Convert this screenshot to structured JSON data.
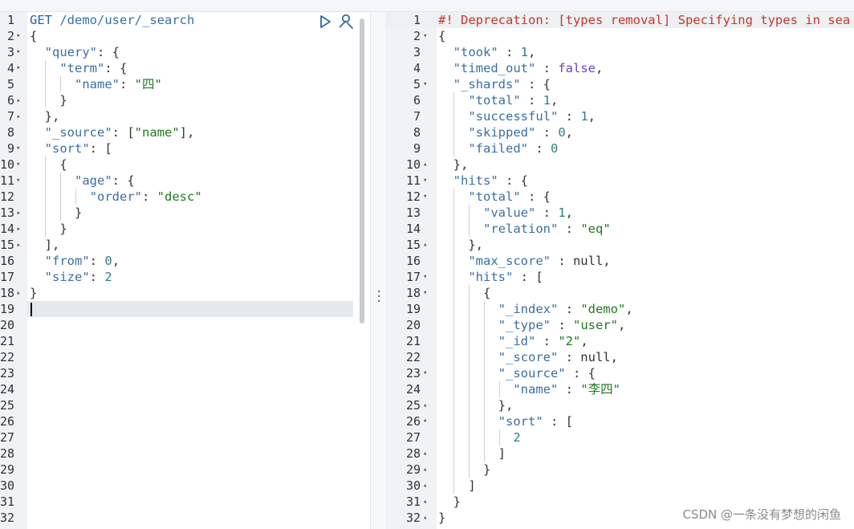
{
  "request": {
    "method": "GET",
    "path": "/demo/user/_search",
    "run_label": "▷",
    "lines": [
      {
        "n": "1",
        "fold": ""
      },
      {
        "n": "2",
        "fold": "▾",
        "t": [
          [
            "p",
            "{"
          ]
        ]
      },
      {
        "n": "3",
        "fold": "▾",
        "t": [
          [
            "p",
            "  "
          ],
          [
            "k",
            "\"query\""
          ],
          [
            "p",
            ": {"
          ]
        ]
      },
      {
        "n": "4",
        "fold": "▾",
        "t": [
          [
            "p",
            "    "
          ],
          [
            "k",
            "\"term\""
          ],
          [
            "p",
            ": {"
          ]
        ]
      },
      {
        "n": "5",
        "fold": "",
        "t": [
          [
            "p",
            "      "
          ],
          [
            "k",
            "\"name\""
          ],
          [
            "p",
            ": "
          ],
          [
            "s",
            "\"四\""
          ]
        ]
      },
      {
        "n": "6",
        "fold": "▴",
        "t": [
          [
            "p",
            "    }"
          ]
        ]
      },
      {
        "n": "7",
        "fold": "▴",
        "t": [
          [
            "p",
            "  },"
          ]
        ]
      },
      {
        "n": "8",
        "fold": "",
        "t": [
          [
            "p",
            "  "
          ],
          [
            "k",
            "\"_source\""
          ],
          [
            "p",
            ": ["
          ],
          [
            "s",
            "\"name\""
          ],
          [
            "p",
            "],"
          ]
        ]
      },
      {
        "n": "9",
        "fold": "▾",
        "t": [
          [
            "p",
            "  "
          ],
          [
            "k",
            "\"sort\""
          ],
          [
            "p",
            ": ["
          ]
        ]
      },
      {
        "n": "10",
        "fold": "▾",
        "t": [
          [
            "p",
            "    {"
          ]
        ]
      },
      {
        "n": "11",
        "fold": "▾",
        "t": [
          [
            "p",
            "      "
          ],
          [
            "k",
            "\"age\""
          ],
          [
            "p",
            ": {"
          ]
        ]
      },
      {
        "n": "12",
        "fold": "",
        "t": [
          [
            "p",
            "        "
          ],
          [
            "k",
            "\"order\""
          ],
          [
            "p",
            ": "
          ],
          [
            "s",
            "\"desc\""
          ]
        ]
      },
      {
        "n": "13",
        "fold": "▴",
        "t": [
          [
            "p",
            "      }"
          ]
        ]
      },
      {
        "n": "14",
        "fold": "▴",
        "t": [
          [
            "p",
            "    }"
          ]
        ]
      },
      {
        "n": "15",
        "fold": "▴",
        "t": [
          [
            "p",
            "  ],"
          ]
        ]
      },
      {
        "n": "16",
        "fold": "",
        "t": [
          [
            "p",
            "  "
          ],
          [
            "k",
            "\"from\""
          ],
          [
            "p",
            ": "
          ],
          [
            "n",
            "0"
          ],
          [
            "p",
            ","
          ]
        ]
      },
      {
        "n": "17",
        "fold": "",
        "t": [
          [
            "p",
            "  "
          ],
          [
            "k",
            "\"size\""
          ],
          [
            "p",
            ": "
          ],
          [
            "n",
            "2"
          ]
        ]
      },
      {
        "n": "18",
        "fold": "▴",
        "t": [
          [
            "p",
            "}"
          ]
        ]
      },
      {
        "n": "19",
        "fold": "",
        "t": []
      },
      {
        "n": "20",
        "fold": "",
        "t": []
      },
      {
        "n": "21",
        "fold": "",
        "t": []
      },
      {
        "n": "22",
        "fold": "",
        "t": []
      },
      {
        "n": "23",
        "fold": "",
        "t": []
      },
      {
        "n": "24",
        "fold": "",
        "t": []
      },
      {
        "n": "25",
        "fold": "",
        "t": []
      },
      {
        "n": "26",
        "fold": "",
        "t": []
      },
      {
        "n": "27",
        "fold": "",
        "t": []
      },
      {
        "n": "28",
        "fold": "",
        "t": []
      },
      {
        "n": "29",
        "fold": "",
        "t": []
      },
      {
        "n": "30",
        "fold": "",
        "t": []
      },
      {
        "n": "31",
        "fold": "",
        "t": []
      },
      {
        "n": "32",
        "fold": "",
        "t": []
      }
    ]
  },
  "response": {
    "lines": [
      {
        "n": "1",
        "fold": "",
        "t": [
          [
            "warn",
            "#! Deprecation: [types removal] Specifying types in sea"
          ]
        ]
      },
      {
        "n": "2",
        "fold": "▾",
        "t": [
          [
            "p",
            "{"
          ]
        ]
      },
      {
        "n": "3",
        "fold": "",
        "t": [
          [
            "p",
            "  "
          ],
          [
            "k",
            "\"took\""
          ],
          [
            "p",
            " : "
          ],
          [
            "n",
            "1"
          ],
          [
            "p",
            ","
          ]
        ]
      },
      {
        "n": "4",
        "fold": "",
        "t": [
          [
            "p",
            "  "
          ],
          [
            "k",
            "\"timed_out\""
          ],
          [
            "p",
            " : "
          ],
          [
            "kw",
            "false"
          ],
          [
            "p",
            ","
          ]
        ]
      },
      {
        "n": "5",
        "fold": "▾",
        "t": [
          [
            "p",
            "  "
          ],
          [
            "k",
            "\"_shards\""
          ],
          [
            "p",
            " : {"
          ]
        ]
      },
      {
        "n": "6",
        "fold": "",
        "t": [
          [
            "p",
            "    "
          ],
          [
            "k",
            "\"total\""
          ],
          [
            "p",
            " : "
          ],
          [
            "n",
            "1"
          ],
          [
            "p",
            ","
          ]
        ]
      },
      {
        "n": "7",
        "fold": "",
        "t": [
          [
            "p",
            "    "
          ],
          [
            "k",
            "\"successful\""
          ],
          [
            "p",
            " : "
          ],
          [
            "n",
            "1"
          ],
          [
            "p",
            ","
          ]
        ]
      },
      {
        "n": "8",
        "fold": "",
        "t": [
          [
            "p",
            "    "
          ],
          [
            "k",
            "\"skipped\""
          ],
          [
            "p",
            " : "
          ],
          [
            "n",
            "0"
          ],
          [
            "p",
            ","
          ]
        ]
      },
      {
        "n": "9",
        "fold": "",
        "t": [
          [
            "p",
            "    "
          ],
          [
            "k",
            "\"failed\""
          ],
          [
            "p",
            " : "
          ],
          [
            "n",
            "0"
          ]
        ]
      },
      {
        "n": "10",
        "fold": "▴",
        "t": [
          [
            "p",
            "  },"
          ]
        ]
      },
      {
        "n": "11",
        "fold": "▾",
        "t": [
          [
            "p",
            "  "
          ],
          [
            "k",
            "\"hits\""
          ],
          [
            "p",
            " : {"
          ]
        ]
      },
      {
        "n": "12",
        "fold": "▾",
        "t": [
          [
            "p",
            "    "
          ],
          [
            "k",
            "\"total\""
          ],
          [
            "p",
            " : {"
          ]
        ]
      },
      {
        "n": "13",
        "fold": "",
        "t": [
          [
            "p",
            "      "
          ],
          [
            "k",
            "\"value\""
          ],
          [
            "p",
            " : "
          ],
          [
            "n",
            "1"
          ],
          [
            "p",
            ","
          ]
        ]
      },
      {
        "n": "14",
        "fold": "",
        "t": [
          [
            "p",
            "      "
          ],
          [
            "k",
            "\"relation\""
          ],
          [
            "p",
            " : "
          ],
          [
            "s",
            "\"eq\""
          ]
        ]
      },
      {
        "n": "15",
        "fold": "▴",
        "t": [
          [
            "p",
            "    },"
          ]
        ]
      },
      {
        "n": "16",
        "fold": "",
        "t": [
          [
            "p",
            "    "
          ],
          [
            "k",
            "\"max_score\""
          ],
          [
            "p",
            " : null,"
          ]
        ]
      },
      {
        "n": "17",
        "fold": "▾",
        "t": [
          [
            "p",
            "    "
          ],
          [
            "k",
            "\"hits\""
          ],
          [
            "p",
            " : ["
          ]
        ]
      },
      {
        "n": "18",
        "fold": "▾",
        "t": [
          [
            "p",
            "      {"
          ]
        ]
      },
      {
        "n": "19",
        "fold": "",
        "t": [
          [
            "p",
            "        "
          ],
          [
            "k",
            "\"_index\""
          ],
          [
            "p",
            " : "
          ],
          [
            "s",
            "\"demo\""
          ],
          [
            "p",
            ","
          ]
        ]
      },
      {
        "n": "20",
        "fold": "",
        "t": [
          [
            "p",
            "        "
          ],
          [
            "k",
            "\"_type\""
          ],
          [
            "p",
            " : "
          ],
          [
            "s",
            "\"user\""
          ],
          [
            "p",
            ","
          ]
        ]
      },
      {
        "n": "21",
        "fold": "",
        "t": [
          [
            "p",
            "        "
          ],
          [
            "k",
            "\"_id\""
          ],
          [
            "p",
            " : "
          ],
          [
            "s",
            "\"2\""
          ],
          [
            "p",
            ","
          ]
        ]
      },
      {
        "n": "22",
        "fold": "",
        "t": [
          [
            "p",
            "        "
          ],
          [
            "k",
            "\"_score\""
          ],
          [
            "p",
            " : null,"
          ]
        ]
      },
      {
        "n": "23",
        "fold": "▾",
        "t": [
          [
            "p",
            "        "
          ],
          [
            "k",
            "\"_source\""
          ],
          [
            "p",
            " : {"
          ]
        ]
      },
      {
        "n": "24",
        "fold": "",
        "t": [
          [
            "p",
            "          "
          ],
          [
            "k",
            "\"name\""
          ],
          [
            "p",
            " : "
          ],
          [
            "s",
            "\"李四\""
          ]
        ]
      },
      {
        "n": "25",
        "fold": "▴",
        "t": [
          [
            "p",
            "        },"
          ]
        ]
      },
      {
        "n": "26",
        "fold": "▾",
        "t": [
          [
            "p",
            "        "
          ],
          [
            "k",
            "\"sort\""
          ],
          [
            "p",
            " : ["
          ]
        ]
      },
      {
        "n": "27",
        "fold": "",
        "t": [
          [
            "p",
            "          "
          ],
          [
            "n",
            "2"
          ]
        ]
      },
      {
        "n": "28",
        "fold": "▴",
        "t": [
          [
            "p",
            "        ]"
          ]
        ]
      },
      {
        "n": "29",
        "fold": "▴",
        "t": [
          [
            "p",
            "      }"
          ]
        ]
      },
      {
        "n": "30",
        "fold": "▴",
        "t": [
          [
            "p",
            "    ]"
          ]
        ]
      },
      {
        "n": "31",
        "fold": "▴",
        "t": [
          [
            "p",
            "  }"
          ]
        ]
      },
      {
        "n": "32",
        "fold": "▴",
        "t": [
          [
            "p",
            "}"
          ]
        ]
      }
    ]
  },
  "icons": {
    "run": "play-triangle",
    "settings": "wrench"
  },
  "watermark": "CSDN @一条没有梦想的闲鱼",
  "colors": {
    "key": "#3a6ea5",
    "string": "#1f7a1f",
    "number": "#2d7d86",
    "warning": "#c0392b",
    "gutter": "#f0f2f5"
  }
}
